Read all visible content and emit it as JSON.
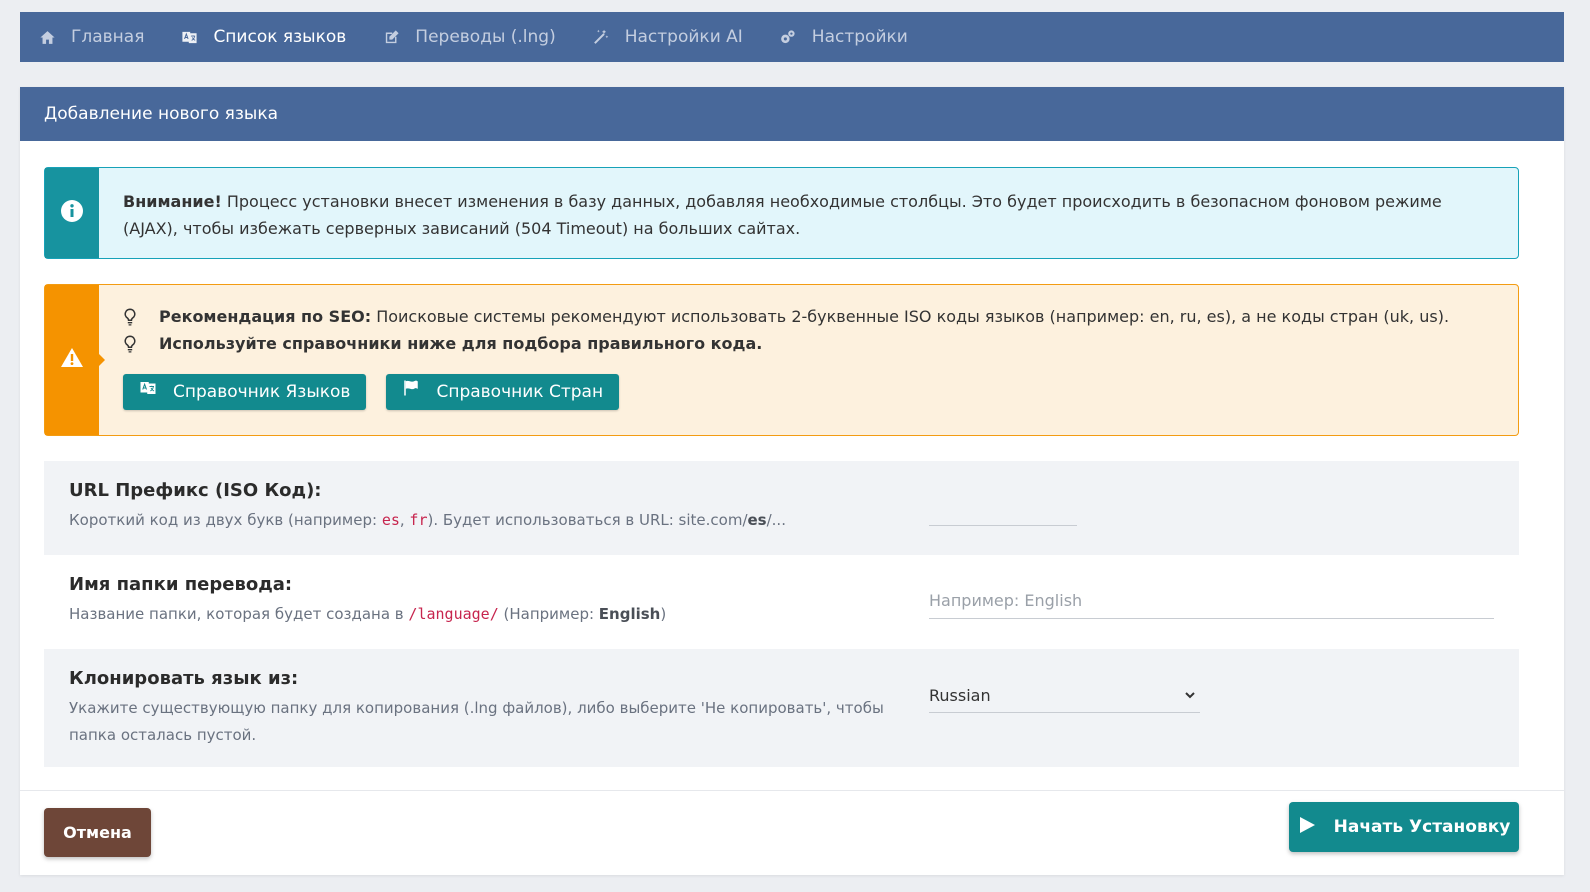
{
  "nav": {
    "items": [
      {
        "label": "Главная",
        "icon": "home-icon"
      },
      {
        "label": "Список языков",
        "icon": "translate-icon"
      },
      {
        "label": "Переводы (.lng)",
        "icon": "edit-icon"
      },
      {
        "label": "Настройки AI",
        "icon": "magic-wand-icon"
      },
      {
        "label": "Настройки",
        "icon": "gears-icon"
      }
    ]
  },
  "panel": {
    "title": "Добавление нового языка"
  },
  "info_alert": {
    "strong": "Внимание!",
    "text": " Процесс установки внесет изменения в базу данных, добавляя необходимые столбцы. Это будет происходить в безопасном фоновом режиме (AJAX), чтобы избежать серверных зависаний (504 Timeout) на больших сайтах."
  },
  "seo_alert": {
    "line1_strong": "Рекомендация по SEO:",
    "line1_text": " Поисковые системы рекомендуют использовать 2-буквенные ISO коды языков (например: en, ru, es), а не коды стран (uk, us).",
    "line2": "Используйте справочники ниже для подбора правильного кода.",
    "btn_languages": "Справочник Языков",
    "btn_countries": "Справочник Стран"
  },
  "form": {
    "prefix": {
      "title": "URL Префикс (ISO Код):",
      "desc_a": "Короткий код из двух букв (например: ",
      "code1": "es",
      "sep": ", ",
      "code2": "fr",
      "desc_b": "). Будет использоваться в URL: site.com/",
      "url_bold": "es",
      "desc_c": "/...",
      "value": ""
    },
    "folder": {
      "title": "Имя папки перевода:",
      "desc_a": "Название папки, которая будет создана в ",
      "code": "/language/",
      "desc_b": " (Например: ",
      "example_bold": "English",
      "desc_c": ")",
      "placeholder": "Например: English"
    },
    "clone": {
      "title": "Клонировать язык из:",
      "desc": "Укажите существующую папку для копирования (.lng файлов), либо выберите 'Не копировать', чтобы папка осталась пустой.",
      "selected": "Russian"
    }
  },
  "footer": {
    "cancel": "Отмена",
    "install": "Начать Установку"
  },
  "colors": {
    "navbar": "#48689a",
    "teal": "#128a8e",
    "warning": "#f59300",
    "cancel": "#6e4638"
  }
}
